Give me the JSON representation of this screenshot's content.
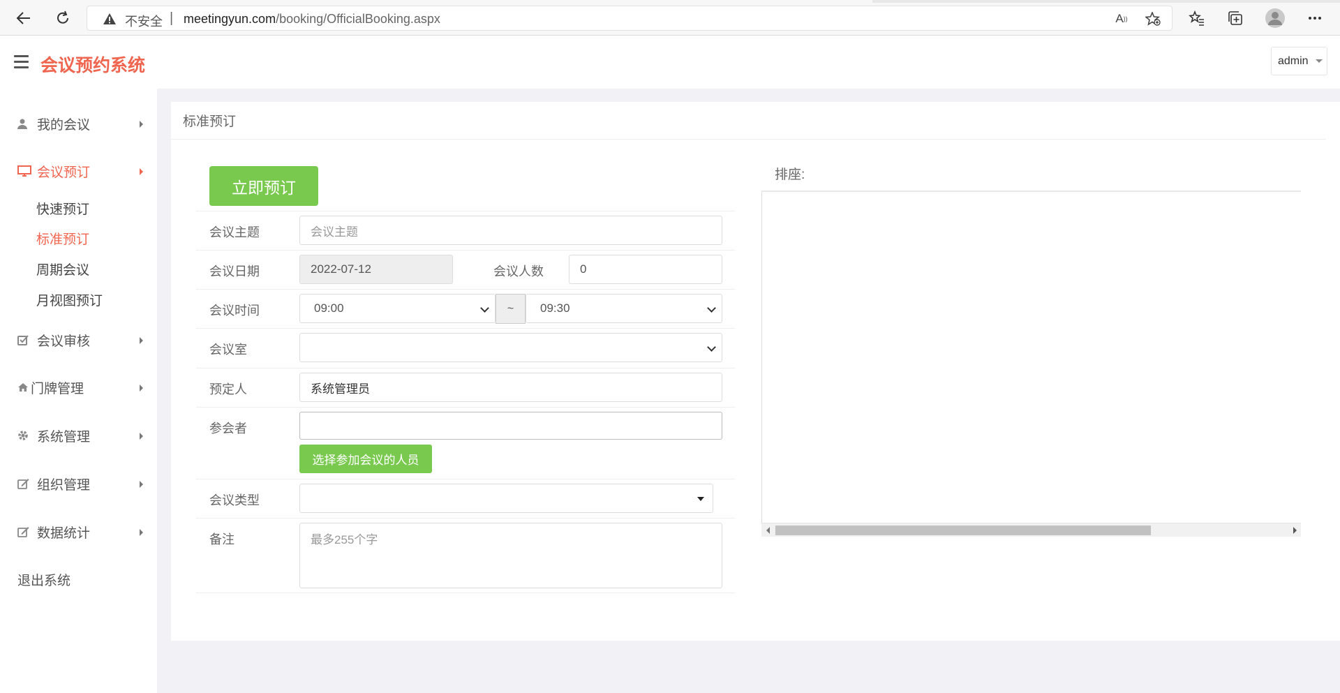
{
  "browser": {
    "insecure_label": "不安全",
    "url_separator": "|",
    "url_host": "meetingyun.com",
    "url_path": "/booking/OfficialBooking.aspx"
  },
  "header": {
    "app_title": "会议预约系统",
    "user": "admin"
  },
  "sidebar": {
    "items": [
      {
        "label": "我的会议"
      },
      {
        "label": "会议预订"
      },
      {
        "label": "会议审核"
      },
      {
        "label": "门牌管理"
      },
      {
        "label": "系统管理"
      },
      {
        "label": "组织管理"
      },
      {
        "label": "数据统计"
      }
    ],
    "sub_items": [
      {
        "label": "快速预订"
      },
      {
        "label": "标准预订"
      },
      {
        "label": "周期会议"
      },
      {
        "label": "月视图预订"
      }
    ],
    "logout": "退出系统"
  },
  "main": {
    "panel_title": "标准预订",
    "book_button": "立即预订",
    "form": {
      "topic_label": "会议主题",
      "topic_placeholder": "会议主题",
      "date_label": "会议日期",
      "date_value": "2022-07-12",
      "people_label": "会议人数",
      "people_value": "0",
      "time_label": "会议时间",
      "start_time": "09:00",
      "time_separator": "~",
      "end_time": "09:30",
      "room_label": "会议室",
      "room_value": "",
      "booker_label": "预定人",
      "booker_value": "系统管理员",
      "attendees_label": "参会者",
      "attendees_value": "",
      "select_attendees_button": "选择参加会议的人员",
      "type_label": "会议类型",
      "type_value": "",
      "remark_label": "备注",
      "remark_placeholder": "最多255个字"
    },
    "seating_label": "排座:"
  },
  "colors": {
    "brand": "#f0654f",
    "primary_button": "#7ac94f"
  }
}
